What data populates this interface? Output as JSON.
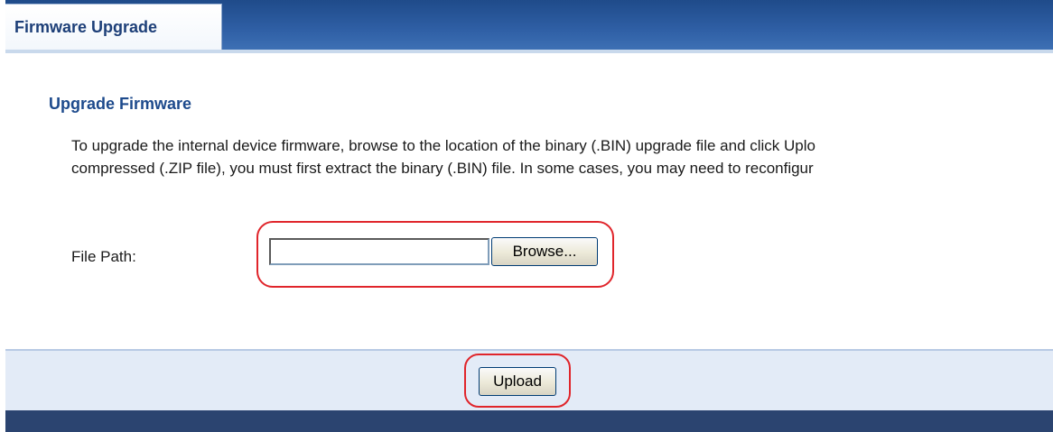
{
  "tab": {
    "label": "Firmware Upgrade"
  },
  "section": {
    "title": "Upgrade Firmware",
    "description_line1": "To upgrade the internal device firmware, browse to the location of the binary (.BIN) upgrade file and click Uplo",
    "description_line2": "compressed (.ZIP file), you must first extract the binary (.BIN) file. In some cases, you may need to reconfigur"
  },
  "form": {
    "file_path_label": "File Path:",
    "file_path_value": "",
    "browse_label": "Browse..."
  },
  "actions": {
    "upload_label": "Upload"
  },
  "colors": {
    "tab_text": "#1d3f78",
    "title_text": "#1d4a8c",
    "highlight": "#e0252b",
    "header_bar": "#2f5fa5",
    "action_bar": "#e3ebf7",
    "footer_bar": "#2b4470"
  }
}
